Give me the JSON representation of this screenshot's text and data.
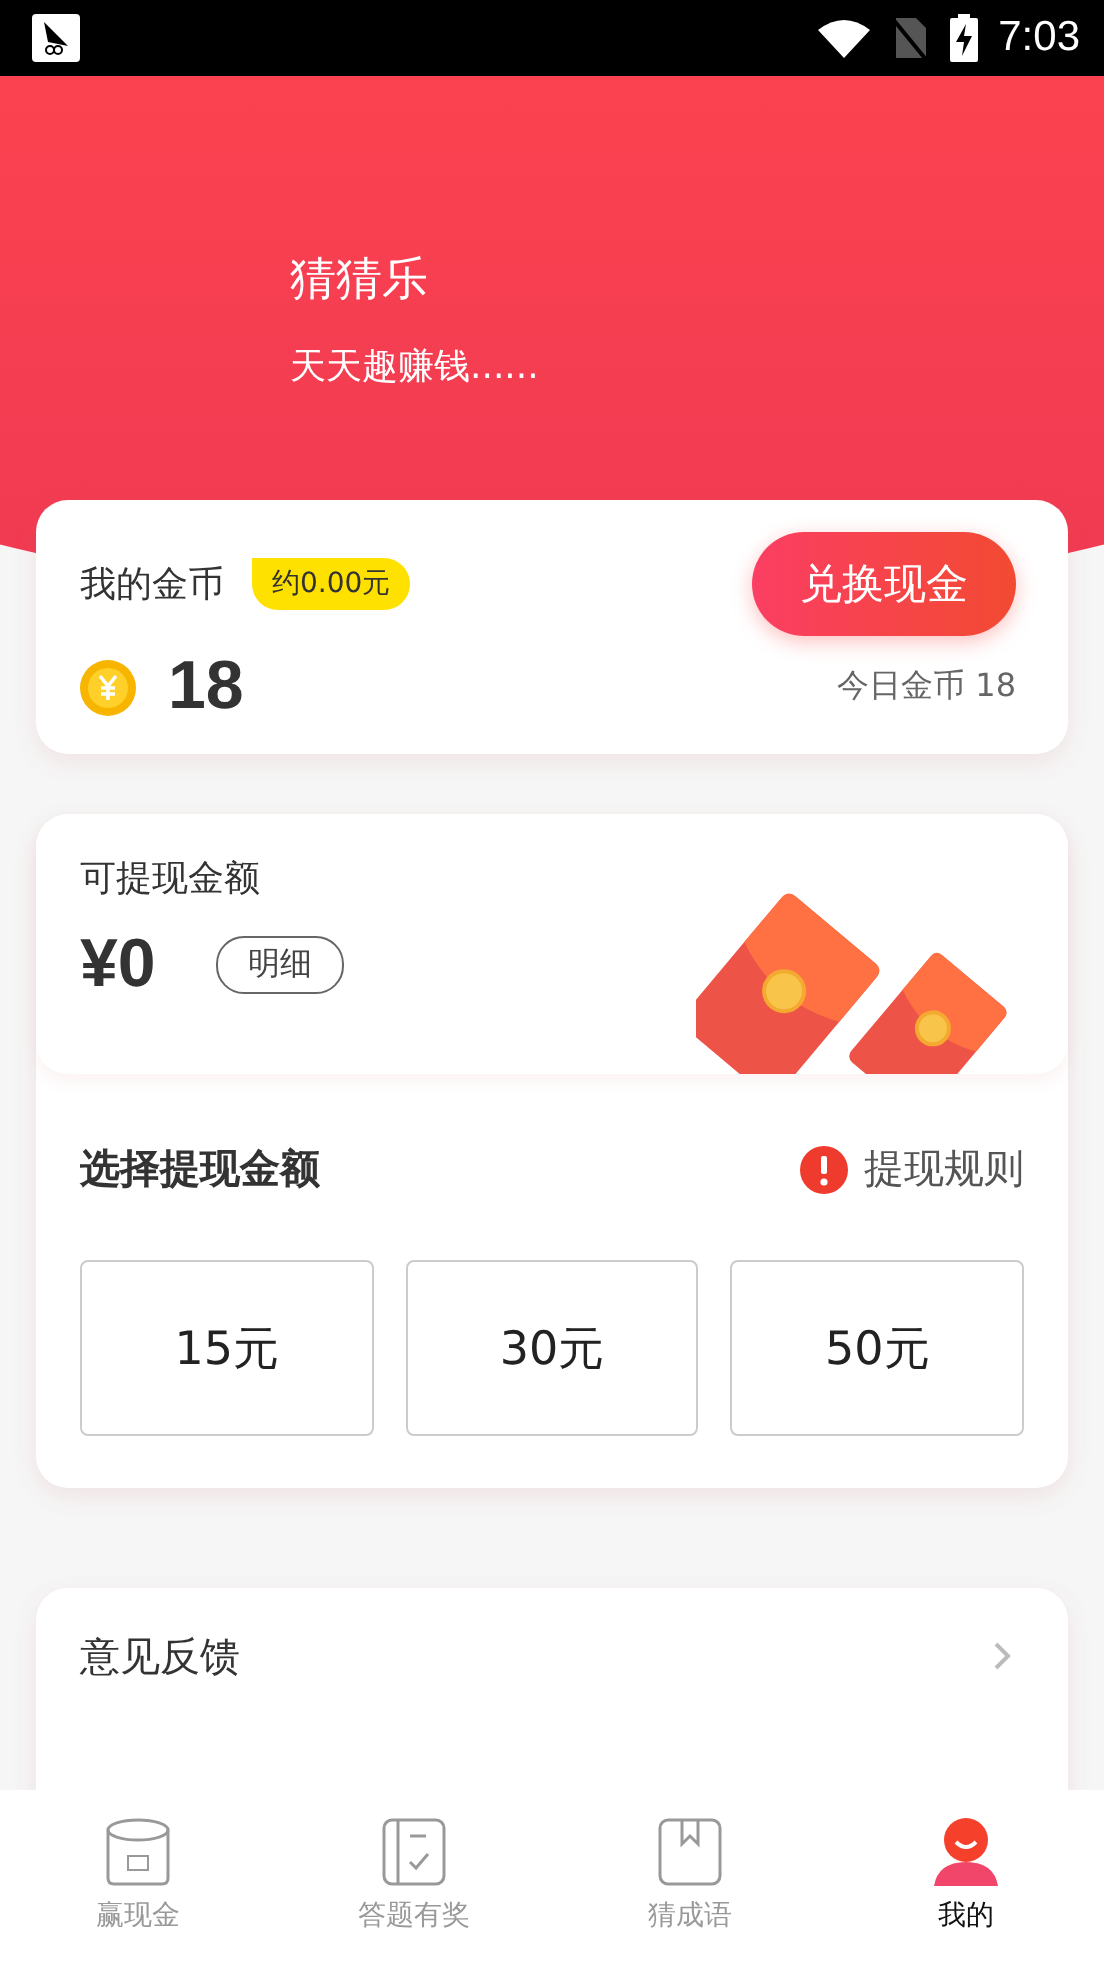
{
  "status_bar": {
    "time": "7:03"
  },
  "header": {
    "title": "猜猜乐",
    "subtitle": "天天趣赚钱......"
  },
  "coins": {
    "label": "我的金币",
    "approx": "约0.00元",
    "amount": "18",
    "button": "兑换现金",
    "today": "今日金币 18"
  },
  "withdraw": {
    "label": "可提现金额",
    "amount": "¥0",
    "detail_button": "明细",
    "section_title": "选择提现金额",
    "rules_link": "提现规则",
    "options": [
      {
        "label": "15元",
        "selected": false
      },
      {
        "label": "30元",
        "selected": false
      },
      {
        "label": "50元",
        "selected": false
      }
    ]
  },
  "menu": [
    {
      "label": "意见反馈"
    }
  ],
  "tab_bar": [
    {
      "label": "赢现金",
      "selected": false
    },
    {
      "label": "答题有奖",
      "selected": false
    },
    {
      "label": "猜成语",
      "selected": false
    },
    {
      "label": "我的",
      "selected": true
    }
  ]
}
